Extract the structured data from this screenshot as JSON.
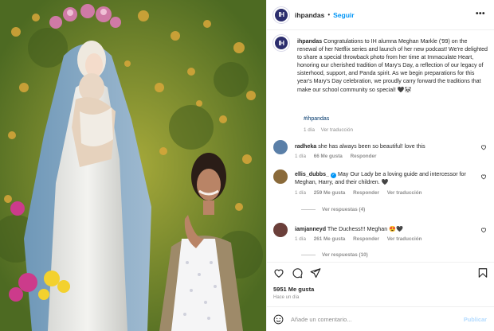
{
  "post": {
    "username": "ihpandas",
    "follow_label": "Seguir",
    "separator": "•",
    "more_label": "•••",
    "avatar_initials": "IH",
    "caption_username": "ihpandas",
    "caption_text": "Congratulations to IH alumna Meghan Markle ('99) on the renewal of her Netflix series and launch of her new podcast! We're delighted to share a special throwback photo from her time at Immaculate Heart, honoring our cherished tradition of Mary's Day, a reflection of our legacy of sisterhood, support, and Panda spirit. As we begin preparations for this year's Mary's Day celebration, we proudly carry forward the traditions that make our school community so special! 🖤🐼",
    "hashtag": "#ihpandas",
    "caption_time": "1 día",
    "see_translation": "Ver traducción"
  },
  "comments": [
    {
      "username": "radheka",
      "text": "she has always been so beautiful! love this",
      "time": "1 día",
      "likes": "66 Me gusta",
      "reply": "Responder",
      "avatar_color": "#5a7fa8"
    },
    {
      "username": "ellis_dubbs_",
      "text": "May Our Lady be a loving guide and intercessor for Meghan, Harry, and their children. 🖤",
      "time": "1 día",
      "likes": "259 Me gusta",
      "reply": "Responder",
      "translation": "Ver traducción",
      "replies": "Ver respuestas (4)",
      "avatar_color": "#8a6a3a"
    },
    {
      "username": "iamjanneyd",
      "text": "The Duchess!!! Meghan 😍🖤",
      "time": "1 día",
      "likes": "261 Me gusta",
      "reply": "Responder",
      "translation": "Ver traducción",
      "replies": "Ver respuestas (10)",
      "avatar_color": "#6b3f3a"
    }
  ],
  "footer": {
    "likes": "5951 Me gusta",
    "time_ago": "Hace un día",
    "comment_placeholder": "Añade un comentario...",
    "publish_label": "Publicar"
  },
  "icons": {
    "like": "heart-icon",
    "comment": "comment-icon",
    "share": "share-icon",
    "save": "bookmark-icon",
    "emoji": "emoji-icon"
  },
  "colors": {
    "link_blue": "#0095f6",
    "hashtag_blue": "#00376b",
    "muted_gray": "#8e8e8e",
    "avatar_navy": "#2c2e6e"
  }
}
